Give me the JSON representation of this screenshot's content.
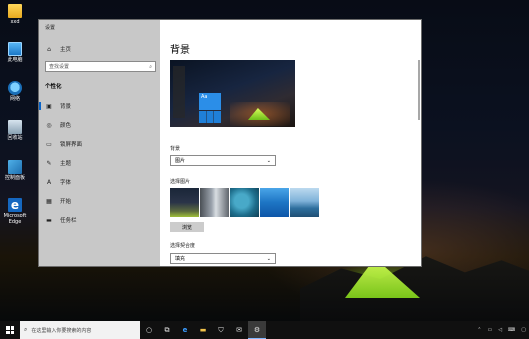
{
  "desktop": {
    "icons": [
      {
        "label": "xxd"
      },
      {
        "label": "此电脑"
      },
      {
        "label": "网络"
      },
      {
        "label": "回收站"
      },
      {
        "label": "控制面板"
      },
      {
        "label": "Microsoft Edge"
      }
    ]
  },
  "window": {
    "title": "设置",
    "controls": {
      "minimize": "–",
      "maximize": "□",
      "close": "✕"
    }
  },
  "sidebar": {
    "home_label": "主页",
    "search_placeholder": "查找设置",
    "section_title": "个性化",
    "items": [
      {
        "label": "背景",
        "icon": "image-icon"
      },
      {
        "label": "颜色",
        "icon": "palette-icon"
      },
      {
        "label": "锁屏界面",
        "icon": "lock-screen-icon"
      },
      {
        "label": "主题",
        "icon": "theme-icon"
      },
      {
        "label": "字体",
        "icon": "font-icon"
      },
      {
        "label": "开始",
        "icon": "start-icon"
      },
      {
        "label": "任务栏",
        "icon": "taskbar-icon"
      }
    ],
    "active_index": 0
  },
  "main": {
    "page_title": "背景",
    "preview_tile_text": "Aa",
    "background_label": "背景",
    "background_value": "图片",
    "choose_picture_label": "选择图片",
    "browse_label": "浏览",
    "fit_label": "选择契合度",
    "fit_value": "填充"
  },
  "taskbar": {
    "search_placeholder": "在这里输入你要搜索的内容"
  },
  "colors": {
    "accent": "#0a64c8",
    "sidebar_bg": "#c8c8c8",
    "taskbar_bg": "#101010"
  }
}
